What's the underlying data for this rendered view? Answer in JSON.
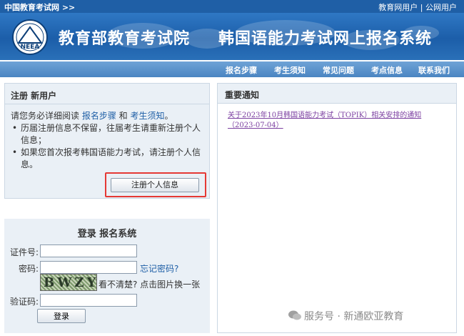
{
  "topbar": {
    "home": "中国教育考试网 >>",
    "links": [
      "教育网用户",
      "公网用户"
    ],
    "separator": " | "
  },
  "banner": {
    "logo_text": "NEEA",
    "org": "教育部教育考试院",
    "system": "韩国语能力考试网上报名系统"
  },
  "nav": {
    "items": [
      "报名步骤",
      "考生须知",
      "常见问题",
      "考点信息",
      "联系我们"
    ]
  },
  "register": {
    "title": "注册 新用户",
    "intro_prefix": "请您务必详细阅读 ",
    "intro_link1": "报名步骤",
    "intro_and": " 和 ",
    "intro_link2": "考生须知",
    "intro_suffix": "。",
    "bullets": [
      "历届注册信息不保留，往届考生请重新注册个人信息；",
      "如果您首次报考韩国语能力考试，请注册个人信息。"
    ],
    "button": "注册个人信息"
  },
  "login": {
    "title": "登录 报名系统",
    "id_label": "证件号:",
    "password_label": "密码:",
    "forgot": "忘记密码?",
    "captcha_text": "BWZY",
    "captcha_hint": "看不清楚? 点击图片换一张",
    "code_label": "验证码:",
    "submit": "登录"
  },
  "notice": {
    "title": "重要通知",
    "items": [
      "关于2023年10月韩国语能力考试（TOPIK）相关安排的通知（2023-07-04）"
    ]
  },
  "watermark": "服务号 · 新通欧亚教育",
  "colors": {
    "primary": "#1f5fa6",
    "panel_bg": "#eaf0f6",
    "highlight_border": "#e53935",
    "notice_link": "#7b3fa0"
  }
}
